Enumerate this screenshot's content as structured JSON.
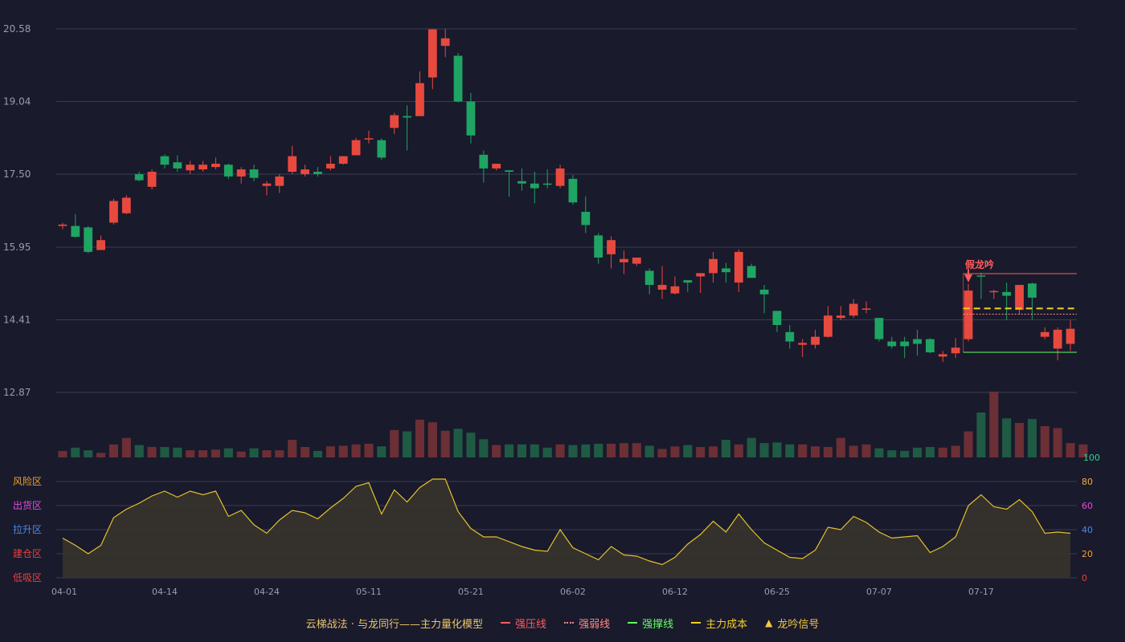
{
  "chart_data": {
    "type": "candlestick",
    "price_ticks": [
      "20.58",
      "19.04",
      "17.50",
      "15.95",
      "14.41",
      "12.87"
    ],
    "ylim": [
      12.87,
      20.58
    ],
    "x_tick_labels": [
      {
        "index": 0,
        "label": "04-01"
      },
      {
        "index": 8,
        "label": "04-14"
      },
      {
        "index": 16,
        "label": "04-24"
      },
      {
        "index": 24,
        "label": "05-11"
      },
      {
        "index": 32,
        "label": "05-21"
      },
      {
        "index": 40,
        "label": "06-02"
      },
      {
        "index": 48,
        "label": "06-12"
      },
      {
        "index": 56,
        "label": "06-25"
      },
      {
        "index": 64,
        "label": "07-07"
      },
      {
        "index": 72,
        "label": "07-17"
      }
    ],
    "candles": [
      [
        16.4,
        16.43,
        16.33,
        16.47
      ],
      [
        16.4,
        16.17,
        16.15,
        16.65
      ],
      [
        16.37,
        15.85,
        15.82,
        16.4
      ],
      [
        15.89,
        16.1,
        15.89,
        16.2
      ],
      [
        16.47,
        16.93,
        16.43,
        16.98
      ],
      [
        16.67,
        17.0,
        16.65,
        17.05
      ],
      [
        17.5,
        17.37,
        17.35,
        17.55
      ],
      [
        17.23,
        17.55,
        17.17,
        17.6
      ],
      [
        17.88,
        17.7,
        17.62,
        17.92
      ],
      [
        17.75,
        17.62,
        17.55,
        17.9
      ],
      [
        17.58,
        17.7,
        17.5,
        17.78
      ],
      [
        17.6,
        17.7,
        17.55,
        17.78
      ],
      [
        17.65,
        17.72,
        17.6,
        17.85
      ],
      [
        17.7,
        17.45,
        17.4,
        17.72
      ],
      [
        17.45,
        17.6,
        17.3,
        17.65
      ],
      [
        17.6,
        17.42,
        17.35,
        17.7
      ],
      [
        17.25,
        17.3,
        17.05,
        17.35
      ],
      [
        17.25,
        17.45,
        17.1,
        17.5
      ],
      [
        17.55,
        17.88,
        17.5,
        18.1
      ],
      [
        17.5,
        17.6,
        17.45,
        17.7
      ],
      [
        17.55,
        17.5,
        17.45,
        17.65
      ],
      [
        17.62,
        17.72,
        17.58,
        17.88
      ],
      [
        17.72,
        17.88,
        17.7,
        17.88
      ],
      [
        17.9,
        18.22,
        17.9,
        18.27
      ],
      [
        18.24,
        18.26,
        18.15,
        18.42
      ],
      [
        18.22,
        17.85,
        17.8,
        18.26
      ],
      [
        18.48,
        18.75,
        18.35,
        18.8
      ],
      [
        18.73,
        18.7,
        18.0,
        18.96
      ],
      [
        18.73,
        19.43,
        18.73,
        19.68
      ],
      [
        19.55,
        20.57,
        19.3,
        20.58
      ],
      [
        20.22,
        20.38,
        19.98,
        20.58
      ],
      [
        20.01,
        19.04,
        19.02,
        20.07
      ],
      [
        19.04,
        18.32,
        18.15,
        19.22
      ],
      [
        17.91,
        17.62,
        17.32,
        18.0
      ],
      [
        17.62,
        17.72,
        17.58,
        17.72
      ],
      [
        17.58,
        17.55,
        17.02,
        17.58
      ],
      [
        17.35,
        17.3,
        17.15,
        17.62
      ],
      [
        17.3,
        17.2,
        16.88,
        17.55
      ],
      [
        17.3,
        17.28,
        17.2,
        17.6
      ],
      [
        17.25,
        17.62,
        17.2,
        17.7
      ],
      [
        17.4,
        16.9,
        16.85,
        17.48
      ],
      [
        16.7,
        16.42,
        16.25,
        17.03
      ],
      [
        16.2,
        15.73,
        15.6,
        16.25
      ],
      [
        15.8,
        16.1,
        15.5,
        16.18
      ],
      [
        15.63,
        15.7,
        15.38,
        15.88
      ],
      [
        15.6,
        15.73,
        15.55,
        15.73
      ],
      [
        15.45,
        15.15,
        14.95,
        15.5
      ],
      [
        15.05,
        15.15,
        14.85,
        15.55
      ],
      [
        14.97,
        15.12,
        14.95,
        15.33
      ],
      [
        15.25,
        15.2,
        15.0,
        15.25
      ],
      [
        15.33,
        15.4,
        14.98,
        15.4
      ],
      [
        15.4,
        15.7,
        15.2,
        15.85
      ],
      [
        15.5,
        15.42,
        15.2,
        15.62
      ],
      [
        15.2,
        15.85,
        15.0,
        15.9
      ],
      [
        15.55,
        15.3,
        15.3,
        15.6
      ],
      [
        15.05,
        14.95,
        14.55,
        15.15
      ],
      [
        14.6,
        14.3,
        14.15,
        14.6
      ],
      [
        14.15,
        13.95,
        13.8,
        14.3
      ],
      [
        13.88,
        13.92,
        13.62,
        14.0
      ],
      [
        13.88,
        14.05,
        13.8,
        14.2
      ],
      [
        14.05,
        14.5,
        14.03,
        14.7
      ],
      [
        14.45,
        14.5,
        14.4,
        14.7
      ],
      [
        14.5,
        14.75,
        14.45,
        14.85
      ],
      [
        14.65,
        14.65,
        14.55,
        14.8
      ],
      [
        14.45,
        14.0,
        13.95,
        14.45
      ],
      [
        13.95,
        13.85,
        13.8,
        14.05
      ],
      [
        13.95,
        13.85,
        13.6,
        14.05
      ],
      [
        14.0,
        13.9,
        13.65,
        14.2
      ],
      [
        14.0,
        13.72,
        13.7,
        14.02
      ],
      [
        13.63,
        13.68,
        13.52,
        13.75
      ],
      [
        13.7,
        13.82,
        13.6,
        14.02
      ],
      [
        14.0,
        15.03,
        13.95,
        15.17
      ],
      [
        15.35,
        15.34,
        14.85,
        15.41
      ],
      [
        15.02,
        15.02,
        14.85,
        15.05
      ],
      [
        15.0,
        14.92,
        14.4,
        15.2
      ],
      [
        14.62,
        15.15,
        14.52,
        15.15
      ],
      [
        15.18,
        14.88,
        14.42,
        15.2
      ],
      [
        14.05,
        14.15,
        14.0,
        14.25
      ],
      [
        13.8,
        14.2,
        13.55,
        14.25
      ],
      [
        13.9,
        14.22,
        13.75,
        14.4
      ]
    ],
    "volume": [
      10,
      15,
      11,
      7,
      20,
      30,
      19,
      16,
      16,
      15,
      11,
      11,
      12,
      14,
      9,
      14,
      11,
      11,
      27,
      16,
      10,
      17,
      18,
      20,
      21,
      17,
      42,
      40,
      58,
      54,
      41,
      44,
      38,
      28,
      19,
      20,
      20,
      20,
      15,
      20,
      19,
      20,
      21,
      21,
      22,
      22,
      18,
      13,
      17,
      19,
      16,
      17,
      27,
      20,
      30,
      22,
      23,
      20,
      20,
      17,
      16,
      30,
      18,
      20,
      14,
      11,
      10,
      15,
      16,
      15,
      18,
      40,
      69,
      101,
      60,
      53,
      59,
      48,
      45,
      22,
      20
    ],
    "volume_max": 101,
    "volume_axis_label": "100",
    "oscillator": {
      "values": [
        33,
        27,
        20,
        27,
        50,
        57,
        62,
        68,
        72,
        67,
        72,
        69,
        72,
        51,
        56,
        44,
        37,
        48,
        56,
        54,
        49,
        58,
        66,
        76,
        79,
        53,
        73,
        63,
        75,
        82,
        82,
        55,
        41,
        34,
        34,
        30,
        26,
        23,
        22,
        40,
        25,
        20,
        15,
        26,
        19,
        18,
        14,
        11,
        17,
        28,
        36,
        47,
        38,
        53,
        40,
        29,
        23,
        17,
        16,
        23,
        42,
        40,
        51,
        46,
        38,
        33,
        34,
        35,
        21,
        26,
        34,
        60,
        69,
        59,
        57,
        65,
        55,
        37,
        38,
        37
      ],
      "ylim": [
        0,
        100
      ],
      "right_ticks": [
        {
          "value": 100,
          "label": "100",
          "color": "#2fd38a"
        },
        {
          "value": 80,
          "label": "80",
          "color": "#f2b134"
        },
        {
          "value": 60,
          "label": "60",
          "color": "#e14be0"
        },
        {
          "value": 40,
          "label": "40",
          "color": "#4a8be8"
        },
        {
          "value": 20,
          "label": "20",
          "color": "#f0a030"
        },
        {
          "value": 0,
          "label": "0",
          "color": "#e84040"
        }
      ],
      "zones": [
        {
          "label": "风险区",
          "value": 80,
          "color": "#f0a030"
        },
        {
          "label": "出货区",
          "value": 60,
          "color": "#e14be0"
        },
        {
          "label": "拉升区",
          "value": 40,
          "color": "#4a8be8"
        },
        {
          "label": "建仓区",
          "value": 20,
          "color": "#e84040"
        },
        {
          "label": "低吸区",
          "value": 0,
          "color": "#e84040"
        }
      ]
    },
    "annotation": {
      "text": "假龙吟",
      "index": 71,
      "color": "#ff5c5c"
    },
    "levels": {
      "resistance": {
        "value": 15.39,
        "from": 71,
        "color": "#ff5c5c"
      },
      "weak": {
        "value": 14.53,
        "from": 71,
        "color": "#ff8a8a"
      },
      "support": {
        "value": 13.72,
        "from": 71,
        "color": "#66ff66"
      },
      "cost": {
        "value": 14.65,
        "from": 71,
        "color": "#f5d020"
      }
    },
    "legend": [
      {
        "label": "云梯战法 · 与龙同行——主力量化模型",
        "color": "#e8c46a",
        "swatch": "none"
      },
      {
        "label": "强压线",
        "color": "#ff5c5c",
        "swatch": "solid"
      },
      {
        "label": "强弱线",
        "color": "#ff8a8a",
        "swatch": "dotted"
      },
      {
        "label": "强撑线",
        "color": "#66ff66",
        "swatch": "solid"
      },
      {
        "label": "主力成本",
        "color": "#f5d020",
        "swatch": "dashed"
      },
      {
        "label": "龙吟信号",
        "color": "#f5c842",
        "swatch": "triangle"
      }
    ],
    "colors": {
      "up": "#e8493e",
      "down": "#1fa463",
      "up_volume": "#6b2f35",
      "down_volume": "#1f5a44",
      "oscillator_line": "#e3c22b",
      "oscillator_fill": "#37332c",
      "grid": "#3a3c52",
      "axis_text": "#9a9cae"
    }
  }
}
